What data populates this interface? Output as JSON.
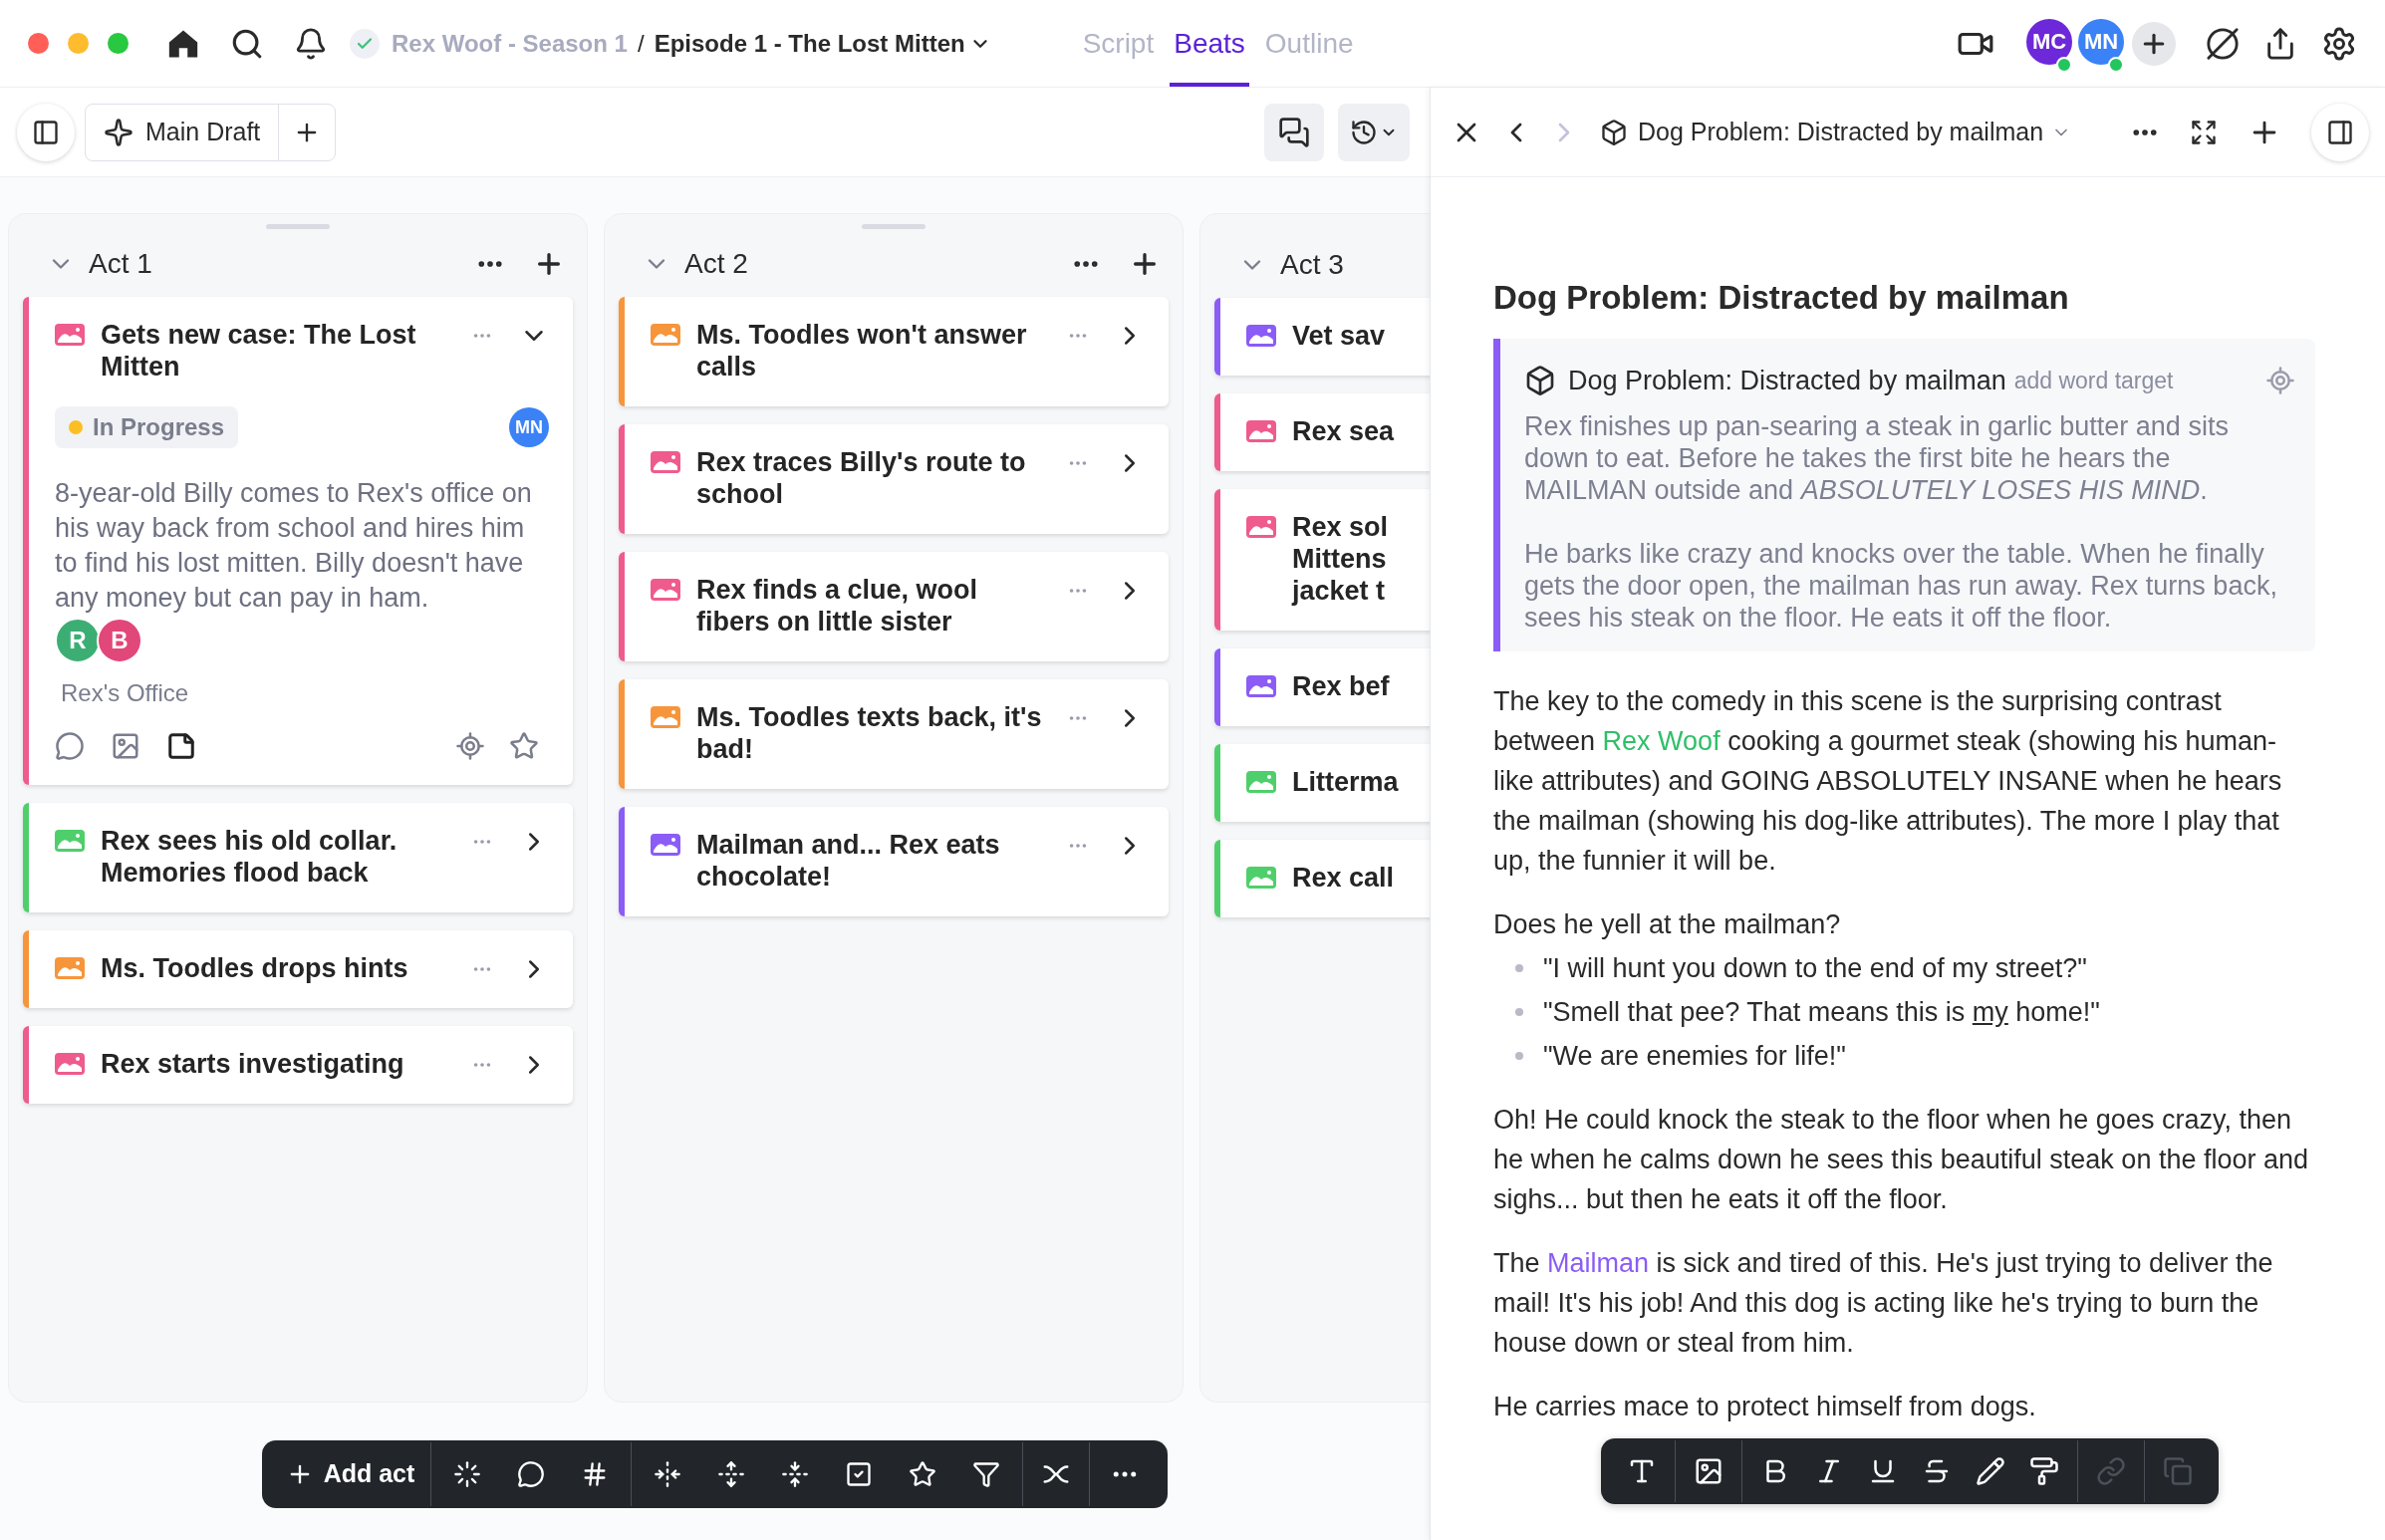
{
  "breadcrumb": {
    "series": "Rex Woof - Season 1",
    "separator": "/",
    "episode": "Episode 1 - The Lost Mitten"
  },
  "view_tabs": [
    {
      "label": "Script",
      "selected": false
    },
    {
      "label": "Beats",
      "selected": true
    },
    {
      "label": "Outline",
      "selected": false
    }
  ],
  "collaborators": [
    {
      "initials": "MC",
      "color": "#6d28d9",
      "online": true
    },
    {
      "initials": "MN",
      "color": "#3b82f6",
      "online": true
    }
  ],
  "draft": {
    "name": "Main Draft"
  },
  "acts": [
    {
      "title": "Act 1",
      "clipped": false,
      "beats": [
        {
          "title": "Gets new case: The Lost Mitten",
          "color": "#ef5b8c",
          "expanded": true,
          "status": {
            "label": "In Progress",
            "color": "#fbbf24"
          },
          "assignee": {
            "initials": "MN",
            "color": "#3b82f6"
          },
          "description": "8-year-old Billy comes to Rex's office on his way back from school and hires him to find his lost mitten. Billy doesn't have any money but can pay in ham.",
          "characters": [
            {
              "initial": "R",
              "color": "#3cae74"
            },
            {
              "initial": "B",
              "color": "#e2477a"
            }
          ],
          "location": "Rex's Office"
        },
        {
          "title": "Rex sees his old collar. Memories flood back",
          "color": "#4fcf6b",
          "expanded": false
        },
        {
          "title": "Ms. Toodles drops hints",
          "color": "#f7953b",
          "expanded": false
        },
        {
          "title": "Rex starts investigating",
          "color": "#ef5b8c",
          "expanded": false
        }
      ]
    },
    {
      "title": "Act 2",
      "clipped": false,
      "beats": [
        {
          "title": "Ms. Toodles won't answer calls",
          "color": "#f7953b",
          "expanded": false
        },
        {
          "title": "Rex traces Billy's route to school",
          "color": "#ef5b8c",
          "expanded": false
        },
        {
          "title": "Rex finds a clue, wool fibers on little sister",
          "color": "#ef5b8c",
          "expanded": false
        },
        {
          "title": "Ms. Toodles texts back, it's bad!",
          "color": "#f7953b",
          "expanded": false
        },
        {
          "title": "Mailman and... Rex eats chocolate!",
          "color": "#8b5cf6",
          "expanded": false
        }
      ]
    },
    {
      "title": "Act 3",
      "clipped": true,
      "beats": [
        {
          "title": "Vet sav",
          "color": "#8b5cf6",
          "expanded": false
        },
        {
          "title": "Rex sea",
          "color": "#ef5b8c",
          "expanded": false
        },
        {
          "title": "Rex sol\nMittens\njacket t",
          "color": "#ef5b8c",
          "expanded": false
        },
        {
          "title": "Rex bef",
          "color": "#8b5cf6",
          "expanded": false
        },
        {
          "title": "Litterma",
          "color": "#4fcf6b",
          "expanded": false
        },
        {
          "title": "Rex call",
          "color": "#4fcf6b",
          "expanded": false
        }
      ]
    }
  ],
  "board_toolbar": {
    "add_label": "Add act"
  },
  "editor": {
    "back_disabled": false,
    "forward_disabled": true,
    "header_title": "Dog Problem: Distracted by mailman",
    "heading": "Dog Problem: Distracted by mailman",
    "synopsis": {
      "title": "Dog Problem: Distracted by mailman",
      "word_target": "add word target",
      "paragraphs": [
        "Rex finishes up pan-searing a steak in garlic butter and sits down to eat. Before he takes the first bite he hears the MAILMAN outside and *ABSOLUTELY LOSES HIS MIND*.",
        "He barks like crazy and knocks over the table. When he finally gets the door open, the mailman has run away. Rex turns back, sees his steak on the floor.  He eats it off the floor."
      ]
    },
    "body": [
      {
        "kind": "paragraph",
        "segments": [
          {
            "kind": "plain",
            "text": "The key to the comedy in this scene is the surprising contrast between "
          },
          {
            "kind": "mention",
            "text": "Rex Woof",
            "color": "#2fbf67"
          },
          {
            "kind": "plain",
            "text": " cooking a gourmet steak (showing his human-like attributes) and GOING ABSOLUTELY INSANE when he hears the mailman (showing his dog-like attributes). The more I play that up, the funnier it will be."
          }
        ]
      },
      {
        "kind": "paragraph",
        "segments": [
          {
            "kind": "plain",
            "text": "Does he yell at the mailman?"
          }
        ]
      },
      {
        "kind": "bullets",
        "items": [
          [
            {
              "kind": "plain",
              "text": "\"I will hunt you down to the end of my street?\""
            }
          ],
          [
            {
              "kind": "plain",
              "text": "\"Smell that pee? That means this is "
            },
            {
              "kind": "underline",
              "text": "my"
            },
            {
              "kind": "plain",
              "text": " home!\""
            }
          ],
          [
            {
              "kind": "plain",
              "text": "\"We are enemies for life!\""
            }
          ]
        ]
      },
      {
        "kind": "paragraph",
        "segments": [
          {
            "kind": "plain",
            "text": "Oh! He could knock the steak to the floor when he goes crazy, then he when he calms down he sees this beautiful steak on the floor and sighs... but then he eats it off the floor."
          }
        ]
      },
      {
        "kind": "paragraph",
        "segments": [
          {
            "kind": "plain",
            "text": "The "
          },
          {
            "kind": "mention",
            "text": "Mailman",
            "color": "#8b5cf6"
          },
          {
            "kind": "plain",
            "text": " is sick and tired of this. He's just trying to deliver the mail! It's his job! And this dog is acting like he's trying to burn the house down or steal from him."
          }
        ]
      },
      {
        "kind": "paragraph",
        "segments": [
          {
            "kind": "plain",
            "text": "He carries mace to protect himself from dogs."
          }
        ]
      }
    ],
    "format_tools": [
      {
        "kind": "text",
        "disabled": false
      },
      {
        "kind": "image",
        "disabled": false
      },
      {
        "kind": "bold",
        "disabled": false
      },
      {
        "kind": "italic",
        "disabled": false
      },
      {
        "kind": "underline",
        "disabled": false
      },
      {
        "kind": "strike",
        "disabled": false
      },
      {
        "kind": "highlight",
        "disabled": false
      },
      {
        "kind": "format",
        "disabled": false
      },
      {
        "kind": "link",
        "disabled": true
      },
      {
        "kind": "copy",
        "disabled": true
      }
    ]
  }
}
